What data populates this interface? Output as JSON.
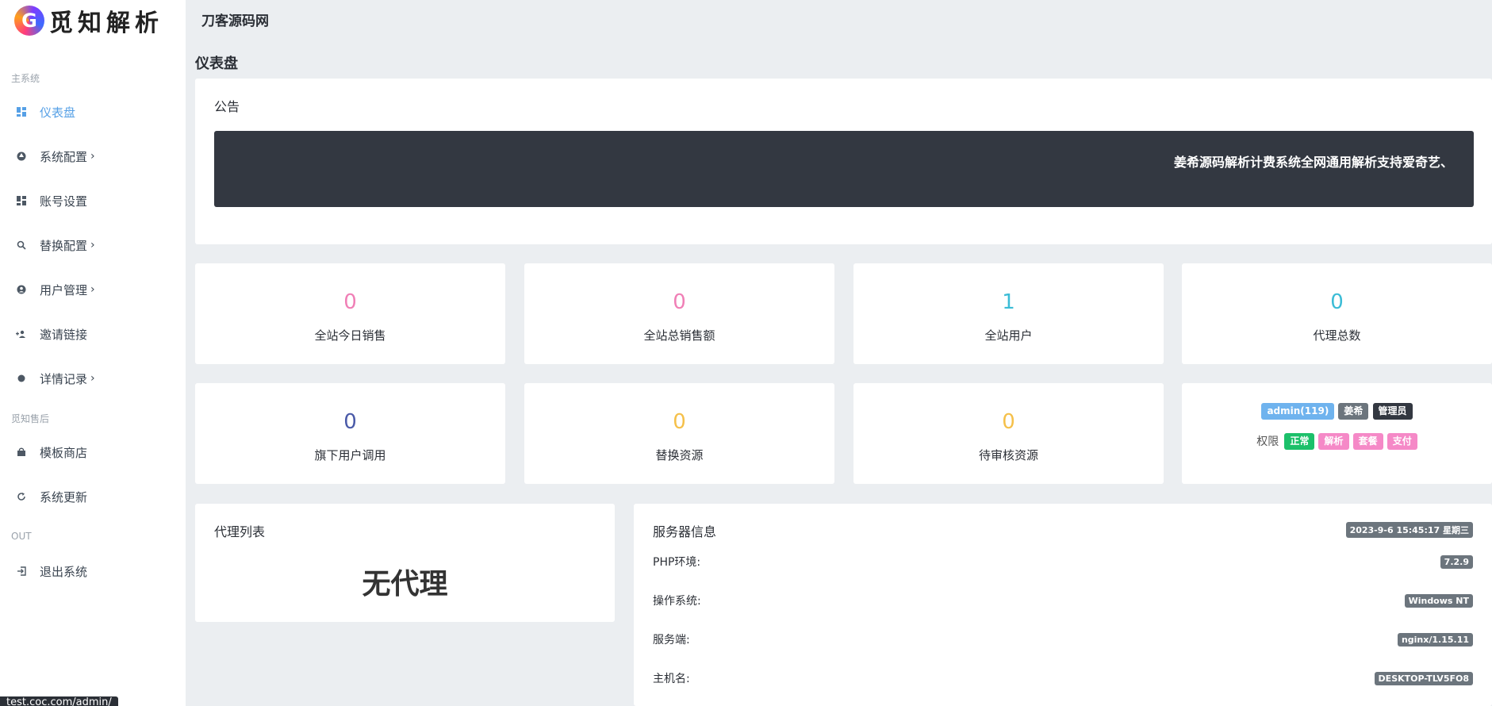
{
  "brand": {
    "logo_letter": "G",
    "name": "觅知解析"
  },
  "topbar": {
    "site_name": "刀客源码网"
  },
  "sidebar": {
    "sections": [
      {
        "label": "主系统"
      },
      {
        "label": "觅知售后"
      },
      {
        "label": "OUT"
      }
    ],
    "items": [
      {
        "label": "仪表盘",
        "icon": "dashboard-icon",
        "active": true
      },
      {
        "label": "系统配置",
        "icon": "settings-icon",
        "chevron": "›"
      },
      {
        "label": "账号设置",
        "icon": "grid-icon"
      },
      {
        "label": "替换配置",
        "icon": "search-icon",
        "chevron": "›"
      },
      {
        "label": "用户管理",
        "icon": "user-icon",
        "chevron": "›"
      },
      {
        "label": "邀请链接",
        "icon": "invite-icon"
      },
      {
        "label": "详情记录",
        "icon": "dot-icon",
        "chevron": "›"
      },
      {
        "label": "模板商店",
        "icon": "bag-icon"
      },
      {
        "label": "系统更新",
        "icon": "refresh-icon"
      },
      {
        "label": "退出系统",
        "icon": "logout-icon"
      }
    ]
  },
  "page": {
    "title": "仪表盘"
  },
  "notice": {
    "title": "公告",
    "text": "姜希源码解析计费系统全网通用解析支持爱奇艺、"
  },
  "stats": [
    {
      "value": "0",
      "label": "全站今日销售",
      "color": "#f07fb6"
    },
    {
      "value": "0",
      "label": "全站总销售额",
      "color": "#f07fb6"
    },
    {
      "value": "1",
      "label": "全站用户",
      "color": "#3bbcd6"
    },
    {
      "value": "0",
      "label": "代理总数",
      "color": "#3bbcd6"
    },
    {
      "value": "0",
      "label": "旗下用户调用",
      "color": "#4a5aa8"
    },
    {
      "value": "0",
      "label": "替换资源",
      "color": "#f5c04a"
    },
    {
      "value": "0",
      "label": "待审核资源",
      "color": "#f5c04a"
    }
  ],
  "account": {
    "user_badge": "admin(119)",
    "name_badge": "姜希",
    "role_badge": "管理员",
    "perm_label": "权限",
    "perms": [
      "正常",
      "解析",
      "套餐",
      "支付"
    ],
    "colors": {
      "user": "#6fb3ee",
      "name": "#6c757d",
      "role": "#333841",
      "ok": "#1cc06a",
      "pink": "#f589c7"
    }
  },
  "agents": {
    "title": "代理列表",
    "empty": "无代理"
  },
  "server": {
    "title": "服务器信息",
    "time": "2023-9-6 15:45:17 星期三",
    "rows": [
      {
        "key": "PHP环境:",
        "value": "7.2.9"
      },
      {
        "key": "操作系统:",
        "value": "Windows NT"
      },
      {
        "key": "服务端:",
        "value": "nginx/1.15.11"
      },
      {
        "key": "主机名:",
        "value": "DESKTOP-TLV5FO8"
      }
    ]
  },
  "status_bar": {
    "url": "test.coc.com/admin/"
  }
}
